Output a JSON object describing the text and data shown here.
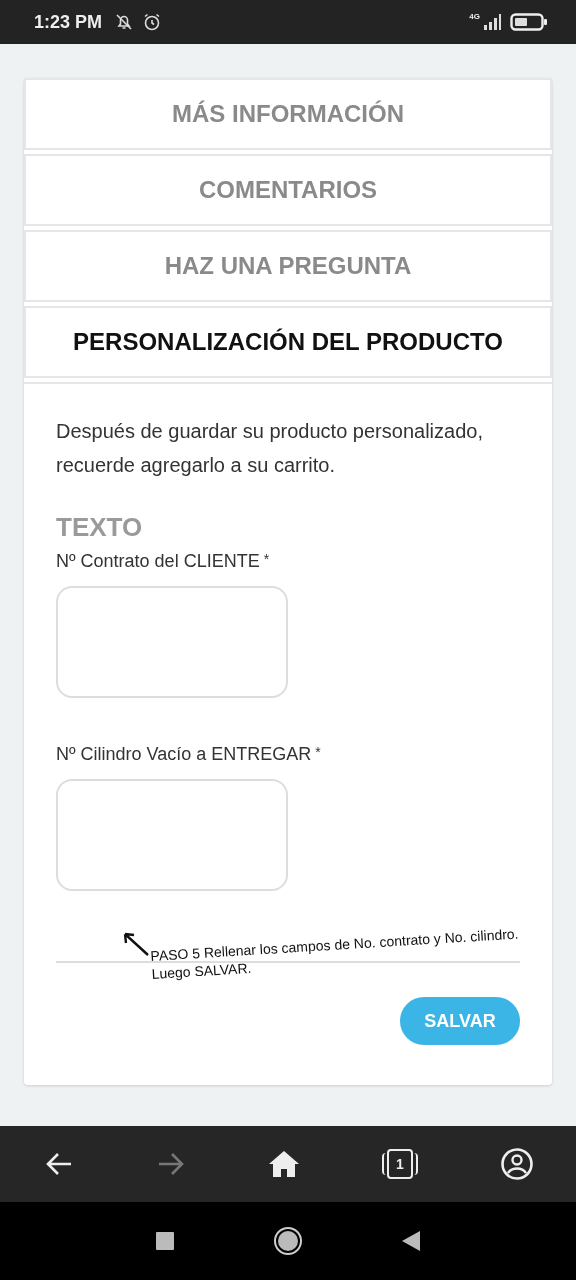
{
  "status_bar": {
    "time": "1:23 PM",
    "network": "4G"
  },
  "tabs": [
    {
      "label": "MÁS INFORMACIÓN",
      "selected": false
    },
    {
      "label": "COMENTARIOS",
      "selected": false
    },
    {
      "label": "HAZ UNA PREGUNTA",
      "selected": false
    },
    {
      "label": "PERSONALIZACIÓN DEL PRODUCTO",
      "selected": true
    }
  ],
  "intro": "Después de guardar su producto personalizado, recuerde agregarlo a su carrito.",
  "section_title": "TEXTO",
  "fields": [
    {
      "label": "Nº Contrato del CLIENTE",
      "required_mark": "*"
    },
    {
      "label": "Nº Cilindro Vacío a ENTREGAR",
      "required_mark": "*"
    }
  ],
  "annotation": "PASO 5  Rellenar los campos de No. contrato y No. cilindro. Luego SALVAR.",
  "save_button": "SALVAR",
  "browser_nav": {
    "back_disabled": false,
    "forward_disabled": true,
    "tab_count": "1"
  }
}
